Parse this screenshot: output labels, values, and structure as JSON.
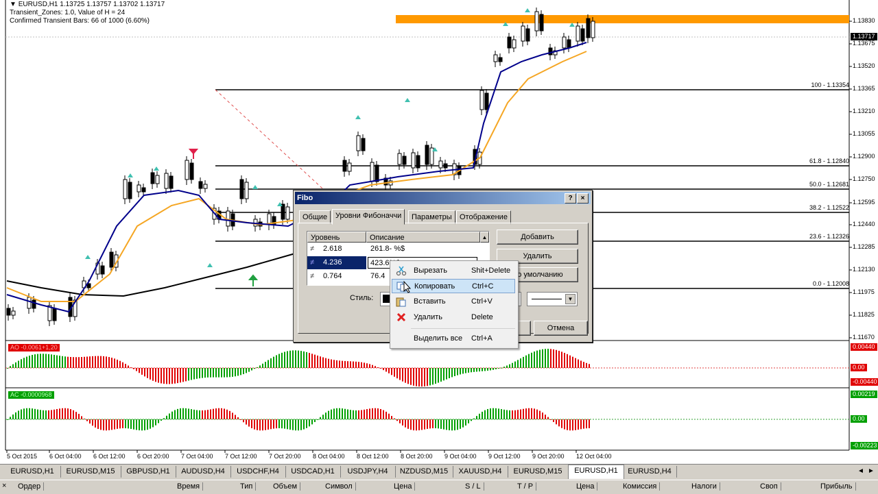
{
  "chart_header": {
    "line1": "EURUSD,H1  1.13725 1.13757 1.13702 1.13717",
    "line2": "Transient_Zones: 1.0, Value of H = 24",
    "line3": "Confirmed Transient Bars: 66 of 1000 (6.60%)"
  },
  "current_price": "1.13717",
  "price_axis": [
    "1.13830",
    "1.13675",
    "1.13520",
    "1.13365",
    "1.13210",
    "1.13055",
    "1.12900",
    "1.12750",
    "1.12595",
    "1.12440",
    "1.12285",
    "1.12130",
    "1.11975",
    "1.11825",
    "1.11670"
  ],
  "fibo_labels": [
    "100 - 1.13354",
    "61.8 - 1.12840",
    "50.0 - 1.12681",
    "38.2 - 1.12522",
    "23.6 - 1.12326",
    "0.0 - 1.12008"
  ],
  "time_axis": [
    "5 Oct 2015",
    "6 Oct 04:00",
    "6 Oct 12:00",
    "6 Oct 20:00",
    "7 Oct 04:00",
    "7 Oct 12:00",
    "7 Oct 20:00",
    "8 Oct 04:00",
    "8 Oct 12:00",
    "8 Oct 20:00",
    "9 Oct 04:00",
    "9 Oct 12:00",
    "9 Oct 20:00",
    "12 Oct 04:00"
  ],
  "indicators": {
    "ao_label": "AO -0.0061+1,20",
    "ao_value": "0.00440",
    "ao_zero": "0.00",
    "ao_min": "-0.00440",
    "ac_label": "AC -0.0000968",
    "ac_value": "0.00219",
    "ac_zero": "0.00",
    "ac_min": "-0.00223"
  },
  "dialog": {
    "title": "Fibo",
    "help": "?",
    "close": "×",
    "tabs": [
      "Общие",
      "Уровни Фибоначчи",
      "Параметры",
      "Отображение"
    ],
    "active_tab": 1,
    "columns": [
      "Уровень",
      "Описание"
    ],
    "rows": [
      {
        "level": "2.618",
        "desc": "261.8- %$"
      },
      {
        "level": "4.236",
        "desc": "423.6%$"
      },
      {
        "level": "0.764",
        "desc": "76.4"
      }
    ],
    "add_button": "Добавить",
    "delete_button": "Удалить",
    "default_button": "По умолчанию",
    "style_label": "Стиль:",
    "cancel_button": "Отмена"
  },
  "context_menu": [
    {
      "label": "Вырезать",
      "shortcut": "Shit+Delete"
    },
    {
      "label": "Копировать",
      "shortcut": "Ctrl+C"
    },
    {
      "label": "Вставить",
      "shortcut": "Ctrl+V"
    },
    {
      "label": "Удалить",
      "shortcut": "Delete"
    },
    {
      "label": "Выделить все",
      "shortcut": "Ctrl+A"
    }
  ],
  "symbol_tabs": [
    "EURUSD,H1",
    "EURUSD,M15",
    "GBPUSD,H1",
    "AUDUSD,H4",
    "USDCHF,H4",
    "USDCAD,H1",
    "USDJPY,H4",
    "NZDUSD,M15",
    "XAUUSD,H4",
    "EURUSD,M15",
    "EURUSD,H1",
    "EURUSD,H4"
  ],
  "active_symbol_tab": 10,
  "terminal_columns": [
    "Ордер",
    "Время",
    "Тип",
    "Объем",
    "Символ",
    "Цена",
    "S / L",
    "T / P",
    "Цена",
    "Комиссия",
    "Налоги",
    "Своп",
    "Прибыль"
  ],
  "colors": {
    "bull": "#000000",
    "ma_fast": "#00008b",
    "ma_slow": "#f5a623",
    "ma_long": "#000000",
    "zone": "#ff9900",
    "ao_up": "#00a000",
    "ao_down": "#e00000"
  }
}
